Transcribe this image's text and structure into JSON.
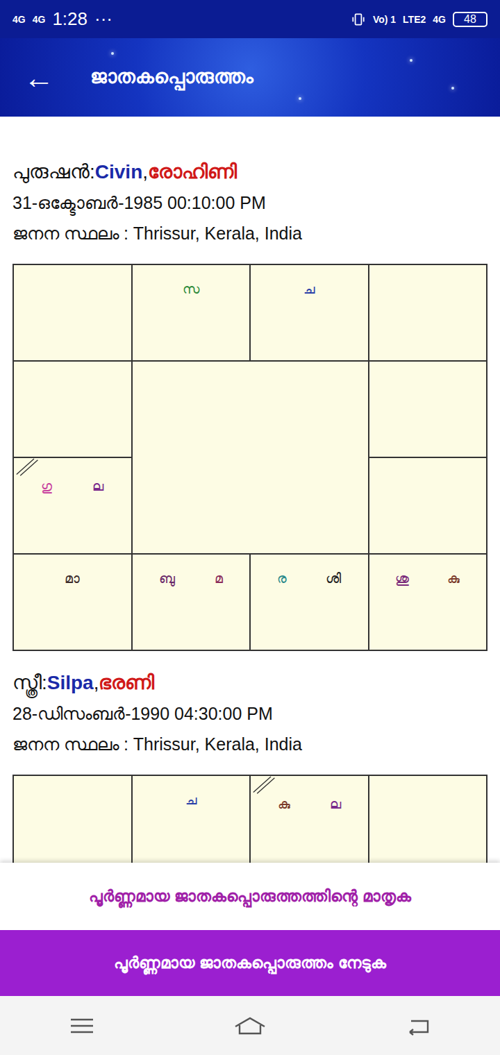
{
  "status_bar": {
    "left": [
      "4G",
      "4G"
    ],
    "time": "1:28",
    "more": "···",
    "right": [
      "Vo) 1",
      "LTE2",
      "4G"
    ],
    "battery": "48"
  },
  "header": {
    "back": "←",
    "title": "ജാതകപ്പൊരുത്തം"
  },
  "profiles": [
    {
      "role": "പുരുഷൻ",
      "name": "Civin",
      "star": "രോഹിണി",
      "datetime": "31-ഒക്ടോബർ-1985 00:10:00 PM",
      "place_label": "ജനന സ്ഥലം",
      "place": "Thrissur, Kerala, India",
      "houses": [
        {
          "lagna": false,
          "planets": []
        },
        {
          "lagna": false,
          "planets": [
            {
              "text": "സ",
              "color": "#2e8b3a"
            }
          ]
        },
        {
          "lagna": false,
          "planets": [
            {
              "text": "ച",
              "color": "#2a3fa8"
            }
          ]
        },
        {
          "lagna": false,
          "planets": []
        },
        {
          "lagna": false,
          "planets": []
        },
        {
          "lagna": false,
          "planets": []
        },
        {
          "lagna": true,
          "planets": [
            {
              "text": "ഗു",
              "color": "#c8409e"
            },
            {
              "text": "ല",
              "color": "#7a2a8c"
            }
          ]
        },
        {
          "lagna": false,
          "planets": []
        },
        {
          "lagna": false,
          "planets": [
            {
              "text": "മാ",
              "color": "#3a2a2a"
            }
          ]
        },
        {
          "lagna": false,
          "planets": [
            {
              "text": "ബു",
              "color": "#6a2a6a"
            },
            {
              "text": "മ",
              "color": "#8a2a5a"
            }
          ]
        },
        {
          "lagna": false,
          "planets": [
            {
              "text": "ര",
              "color": "#2a8a8a"
            },
            {
              "text": "ശി",
              "color": "#222222"
            }
          ]
        },
        {
          "lagna": false,
          "planets": [
            {
              "text": "ശു",
              "color": "#7a2a7a"
            },
            {
              "text": "കു",
              "color": "#7a3a2a"
            }
          ]
        }
      ]
    },
    {
      "role": "സ്ത്രീ",
      "name": "Silpa",
      "star": "ഭരണി",
      "datetime": "28-ഡിസംബർ-1990 04:30:00 PM",
      "place_label": "ജനന സ്ഥലം",
      "place": "Thrissur, Kerala, India",
      "houses": [
        {
          "lagna": false,
          "planets": []
        },
        {
          "lagna": false,
          "planets": [
            {
              "text": "ച",
              "color": "#2a3fa8"
            }
          ]
        },
        {
          "lagna": true,
          "planets": [
            {
              "text": "കു",
              "color": "#7a3a2a"
            },
            {
              "text": "ല",
              "color": "#7a2a8c"
            }
          ]
        },
        {
          "lagna": false,
          "planets": []
        },
        {
          "lagna": false,
          "planets": []
        },
        {
          "lagna": false,
          "planets": []
        },
        {
          "lagna": false,
          "planets": []
        },
        {
          "lagna": false,
          "planets": []
        },
        {
          "lagna": false,
          "planets": []
        },
        {
          "lagna": false,
          "planets": []
        },
        {
          "lagna": false,
          "planets": []
        },
        {
          "lagna": false,
          "planets": []
        }
      ]
    }
  ],
  "sample_link": "പൂർണ്ണമായ ജാതകപ്പൊരുത്തത്തിന്റെ മാതൃക",
  "cta_button": "പൂർണ്ണമായ ജാതകപ്പൊരുത്തം നേടുക"
}
